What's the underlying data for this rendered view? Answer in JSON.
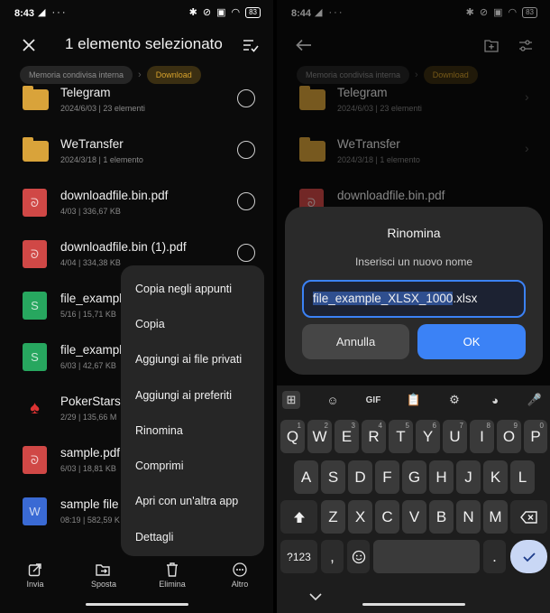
{
  "left": {
    "status": {
      "time": "8:43",
      "left_icons": "◢ ···",
      "right_icons": [
        "bluetooth-icon",
        "mute-icon",
        "no-sim-icon",
        "wifi-icon"
      ],
      "battery": "83"
    },
    "title": "1 elemento selezionato",
    "breadcrumbs": [
      "Memoria condivisa interna",
      "Download"
    ],
    "files": [
      {
        "name": "Telegram",
        "meta": "2024/6/03 | 23 elementi",
        "type": "folder"
      },
      {
        "name": "WeTransfer",
        "meta": "2024/3/18 | 1 elemento",
        "type": "folder"
      },
      {
        "name": "downloadfile.bin.pdf",
        "meta": "4/03 | 336,67 KB",
        "type": "pdf"
      },
      {
        "name": "downloadfile.bin (1).pdf",
        "meta": "4/04 | 334,38 KB",
        "type": "pdf"
      },
      {
        "name": "file_exampl",
        "meta": "5/16 | 15,71 KB",
        "type": "xls"
      },
      {
        "name": "file_exampl",
        "meta": "6/03 | 42,67 KB",
        "type": "xls"
      },
      {
        "name": "PokerStars",
        "meta": "2/29 | 135,66 M",
        "type": "poker"
      },
      {
        "name": "sample.pdf",
        "meta": "6/03 | 18,81 KB",
        "type": "pdf"
      },
      {
        "name": "sample file",
        "meta": "08:19 | 582,59 K",
        "type": "doc"
      }
    ],
    "menu": [
      "Copia negli appunti",
      "Copia",
      "Aggiungi ai file privati",
      "Aggiungi ai preferiti",
      "Rinomina",
      "Comprimi",
      "Apri con un'altra app",
      "Dettagli"
    ],
    "bottom": [
      {
        "label": "Invia",
        "icon": "share-icon"
      },
      {
        "label": "Sposta",
        "icon": "move-icon"
      },
      {
        "label": "Elimina",
        "icon": "trash-icon"
      },
      {
        "label": "Altro",
        "icon": "more-icon"
      }
    ]
  },
  "right": {
    "status": {
      "time": "8:44",
      "left_icons": "◢ ···",
      "battery": "83"
    },
    "breadcrumbs": [
      "Memoria condivisa interna",
      "Download"
    ],
    "files": [
      {
        "name": "Telegram",
        "meta": "2024/6/03 | 23 elementi",
        "type": "folder"
      },
      {
        "name": "WeTransfer",
        "meta": "2024/3/18 | 1 elemento",
        "type": "folder"
      },
      {
        "name": "downloadfile.bin.pdf",
        "meta": "",
        "type": "pdf"
      }
    ],
    "dialog": {
      "title": "Rinomina",
      "subtitle": "Inserisci un nuovo nome",
      "value_selected": "file_example_XLSX_1000",
      "value_ext": ".xlsx",
      "cancel": "Annulla",
      "ok": "OK"
    },
    "keyboard": {
      "row1": [
        "Q",
        "W",
        "E",
        "R",
        "T",
        "Y",
        "U",
        "I",
        "O",
        "P"
      ],
      "row1_hints": [
        "1",
        "2",
        "3",
        "4",
        "5",
        "6",
        "7",
        "8",
        "9",
        "0"
      ],
      "row2": [
        "A",
        "S",
        "D",
        "F",
        "G",
        "H",
        "J",
        "K",
        "L"
      ],
      "row3": [
        "Z",
        "X",
        "C",
        "V",
        "B",
        "N",
        "M"
      ],
      "symbols": "?123",
      "comma": ",",
      "period": ".",
      "gif": "GIF"
    }
  }
}
